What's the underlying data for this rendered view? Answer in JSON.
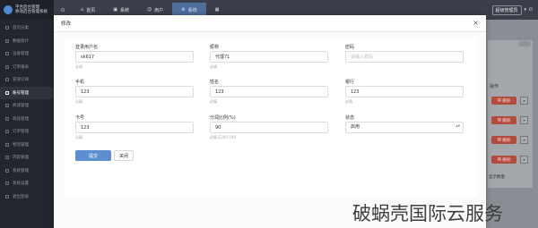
{
  "app": {
    "logo_text_1": "平台后台管理",
    "logo_text_2": "移动后台管理系统"
  },
  "sidebar": {
    "items": [
      {
        "label": "首页分类"
      },
      {
        "label": "数据统计"
      },
      {
        "label": "设备管理"
      },
      {
        "label": "订单报表"
      },
      {
        "label": "充值订阅"
      },
      {
        "label": "账号管理"
      },
      {
        "label": "商城管理"
      },
      {
        "label": "商品管理"
      },
      {
        "label": "订单管理"
      },
      {
        "label": "物流管理"
      },
      {
        "label": "内容管理"
      },
      {
        "label": "系统管理"
      },
      {
        "label": "系统设置"
      },
      {
        "label": "退出登录"
      }
    ],
    "active_index": 5
  },
  "topbar": {
    "tabs": [
      {
        "icon": "home-icon",
        "label": "首页"
      },
      {
        "icon": "doc-icon",
        "label": "系统"
      },
      {
        "icon": "user-icon",
        "label": "用户"
      },
      {
        "icon": "gear-icon",
        "label": "系统"
      }
    ],
    "active_tab": 3,
    "user_name": "超级管理员"
  },
  "background_table": {
    "header": "操作",
    "delete_label": "删除",
    "page_size_label": "显示数量"
  },
  "modal": {
    "title": "修改",
    "close_glyph": "×",
    "fields": {
      "username": {
        "label": "登录用户名",
        "value": "sk617",
        "help": "必填"
      },
      "nickname": {
        "label": "昵称",
        "value": "代理71",
        "help": "必填"
      },
      "password": {
        "label": "密码",
        "value": "",
        "placeholder": "请输入密码"
      },
      "phone": {
        "label": "手机",
        "value": "123",
        "help": "必填"
      },
      "realname": {
        "label": "姓名",
        "value": "123",
        "help": "必填"
      },
      "bank": {
        "label": "银行",
        "value": "123",
        "help": "必填"
      },
      "card": {
        "label": "卡号",
        "value": "123",
        "help": "必填"
      },
      "ratio": {
        "label": "分润比例(%)",
        "value": "90",
        "help": "必填 区间0-100"
      },
      "status": {
        "label": "状态",
        "value": "启用",
        "arrows": "▴▾"
      }
    },
    "submit_label": "提交",
    "close_label": "关闭"
  },
  "watermark": "破蜗壳国际云服务",
  "colors": {
    "primary": "#5b8fd0",
    "danger": "#b34b3f",
    "sidebar_bg": "#23262e"
  }
}
